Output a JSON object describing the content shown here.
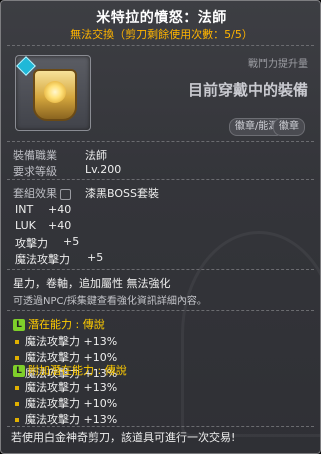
{
  "item": {
    "title": "米特拉的憤怒：法師",
    "subtitle": "無法交換（剪刀剩餘使用次數：5/5）",
    "boost_label": "戰鬥力提升量",
    "equipped_label": "目前穿戴中的裝備",
    "icon": "mitra-emblem-icon"
  },
  "buttons": {
    "emblem_secondary": "徽章/能源",
    "emblem": "徽章"
  },
  "req": {
    "job_label": "裝備職業",
    "job_value": "法師",
    "level_label": "要求等級",
    "level_value": "Lv.200"
  },
  "set": {
    "label": "套組效果",
    "value": "漆黑BOSS套裝"
  },
  "stats": [
    {
      "name": "INT",
      "value": "+40"
    },
    {
      "name": "LUK",
      "value": "+40"
    },
    {
      "name": "攻擊力",
      "value": "+5"
    },
    {
      "name": "魔法攻擊力",
      "value": "+5"
    }
  ],
  "info": {
    "line1": "星力，卷軸，追加屬性 無法強化",
    "line2": "可透過NPC/採集鍵查看強化資訊詳細內容。"
  },
  "potential": {
    "title": "潛在能力 : 傳說",
    "icon": "legendary-icon",
    "lines": [
      "魔法攻擊力 +13%",
      "魔法攻擊力 +10%",
      "魔法攻擊力 +13%"
    ]
  },
  "bonus_potential": {
    "title": "附加潛在能力 : 傳說",
    "icon": "legendary-icon",
    "lines": [
      "魔法攻擊力 +13%",
      "魔法攻擊力 +10%",
      "魔法攻擊力 +13%"
    ]
  },
  "footer": "若使用白金神奇剪刀，該道具可進行一次交易!",
  "colors": {
    "gold": "#ffcc00",
    "legendary": "#7fcf2a",
    "subtitle": "#ffb400"
  }
}
